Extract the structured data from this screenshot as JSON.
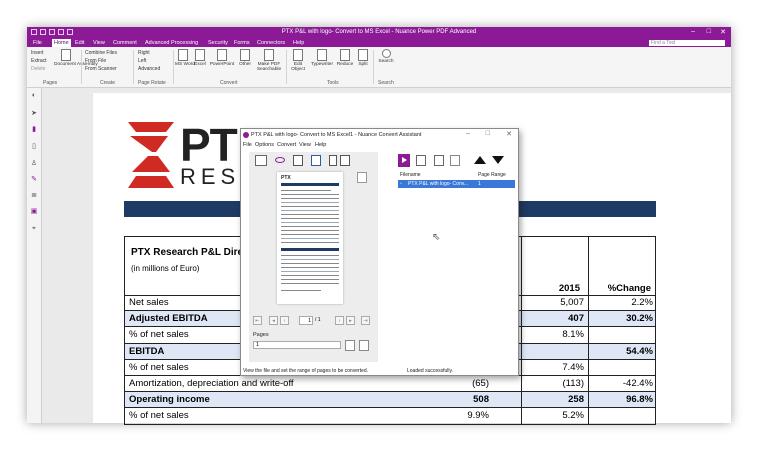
{
  "window": {
    "title": "PTX P&L with logo- Convert to MS Excel - Nuance Power PDF Advanced",
    "find_placeholder": "Find a Tool",
    "controls": {
      "minimize": "–",
      "maximize": "□",
      "close": "✕"
    }
  },
  "menu": [
    "File",
    "Home",
    "Edit",
    "View",
    "Comment",
    "Advanced Processing",
    "Security",
    "Forms",
    "Connectors",
    "Help"
  ],
  "menu_active": "Home",
  "ribbon": {
    "pages_small": [
      "Insert",
      "Extract",
      "Delete"
    ],
    "document_assembly": "Document Assembly",
    "create_small": [
      "Combine Files",
      "From File",
      "From Scanner"
    ],
    "rotate_small": [
      "Right",
      "Left",
      "Advanced"
    ],
    "convert_buttons": [
      "MS Word",
      "Excel",
      "PowerPoint",
      "Other",
      "Make PDF Searchable",
      "Edit Object"
    ],
    "tools_buttons": [
      "Typewriter",
      "Reduce",
      "Split"
    ],
    "search_button": "Search",
    "groups": [
      "Pages",
      "Create",
      "Page Rotate",
      "Convert",
      "Tools",
      "Search"
    ]
  },
  "document": {
    "logo_text_1": "PT",
    "logo_text_2": "RESEA",
    "table_title": "PTX Research P&L Dire",
    "table_subtitle": "(in millions of Euro)",
    "columns": [
      "",
      "",
      "2015",
      "%Change"
    ],
    "rows": [
      {
        "label": "Net sales",
        "v1": "",
        "v2": "5,007",
        "v3": "2.2%",
        "hl": false
      },
      {
        "label": "Adjusted EBITDA",
        "v1": "",
        "v2": "407",
        "v3": "30.2%",
        "hl": true
      },
      {
        "label": "% of net sales",
        "v1": "",
        "v2": "8.1%",
        "v3": "",
        "hl": false
      },
      {
        "label": "EBITDA",
        "v1": "",
        "v2": "",
        "v3": "54.4%",
        "hl": true
      },
      {
        "label": "% of net sales",
        "v1": "",
        "v2": "7.4%",
        "v3": "",
        "hl": false
      },
      {
        "label": "Amortization, depreciation and write-off",
        "v1": "(65)",
        "v2": "(113)",
        "v3": "-42.4%",
        "hl": false
      },
      {
        "label": "Operating income",
        "v1": "508",
        "v2": "258",
        "v3": "96.8%",
        "hl": true
      },
      {
        "label": "% of net sales",
        "v1": "9.9%",
        "v2": "5.2%",
        "v3": "",
        "hl": false
      }
    ]
  },
  "dialog": {
    "title": "PTX P&L with logo- Convert to MS Excel1 - Nuance Convert Assistant",
    "menu": [
      "File",
      "Options",
      "Convert",
      "View",
      "Help"
    ],
    "thumb_label": "PTX",
    "page_input": "1",
    "page_total": "/ 1",
    "pages_label": "Pages",
    "pages_value": "1",
    "file_header": {
      "filename": "Filename",
      "range": "Page Range"
    },
    "file_row": {
      "name": "PTX P&L with logo- Conv...",
      "range": "1"
    },
    "status_left": "View the file and set the range of pages to be converted.",
    "status_right": "Loaded successfully."
  }
}
